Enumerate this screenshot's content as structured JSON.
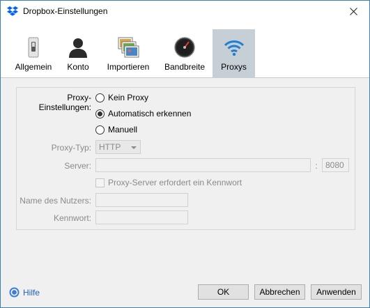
{
  "window": {
    "title": "Dropbox-Einstellungen"
  },
  "tabs": [
    {
      "label": "Allgemein",
      "icon": "switch-icon"
    },
    {
      "label": "Konto",
      "icon": "user-icon"
    },
    {
      "label": "Importieren",
      "icon": "photos-icon"
    },
    {
      "label": "Bandbreite",
      "icon": "gauge-icon"
    },
    {
      "label": "Proxys",
      "icon": "wifi-icon",
      "active": true
    }
  ],
  "proxy": {
    "settings_label": "Proxy-Einstellungen:",
    "options": [
      {
        "label": "Kein Proxy",
        "checked": false
      },
      {
        "label": "Automatisch erkennen",
        "checked": true
      },
      {
        "label": "Manuell",
        "checked": false
      }
    ],
    "type_label": "Proxy-Typ:",
    "type_value": "HTTP",
    "server_label": "Server:",
    "server_value": "",
    "port_separator": ":",
    "port_value": "8080",
    "auth_checkbox_label": "Proxy-Server erfordert ein Kennwort",
    "username_label": "Name des Nutzers:",
    "username_value": "",
    "password_label": "Kennwort:",
    "password_value": ""
  },
  "footer": {
    "help_label": "Hilfe",
    "ok_label": "OK",
    "cancel_label": "Abbrechen",
    "apply_label": "Anwenden"
  },
  "colors": {
    "accent": "#0061fe",
    "active_tab": "#c6ced6",
    "link": "#1a62c4",
    "disabled_text": "#8a8a8a"
  }
}
